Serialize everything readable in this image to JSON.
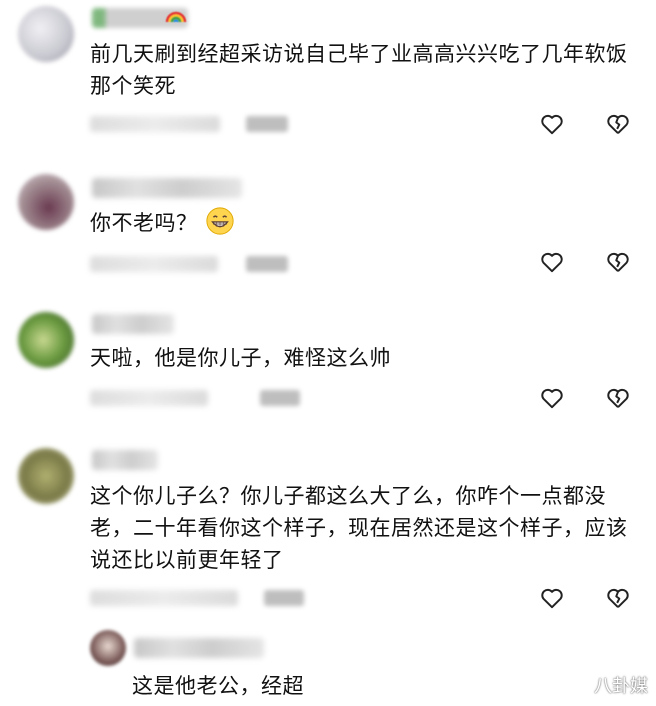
{
  "comments": [
    {
      "text": "前几天刷到经超采访说自己毕了业高高兴兴吃了几年软饭那个笑死",
      "avatar_color": "#d9d9df"
    },
    {
      "text": "你不老吗？",
      "emoji": "grin-emoji",
      "avatar_color": "#7a5a66"
    },
    {
      "text": "天啦，他是你儿子，难怪这么帅",
      "avatar_color": "#6a8a3a"
    },
    {
      "text": "这个你儿子么？你儿子都这么大了么，你咋个一点都没老，二十年看你这个样子，现在居然还是这个样子，应该说还比以前更年轻了",
      "avatar_color": "#8a8a5a"
    }
  ],
  "reply": {
    "text": "这是他老公，经超",
    "avatar_color": "#6a5a5a"
  },
  "icons": {
    "like": "heart-icon",
    "dislike": "broken-heart-icon"
  },
  "watermark": {
    "text": "八/\\怪/\\媒",
    "logo": "weibo-logo-icon"
  }
}
